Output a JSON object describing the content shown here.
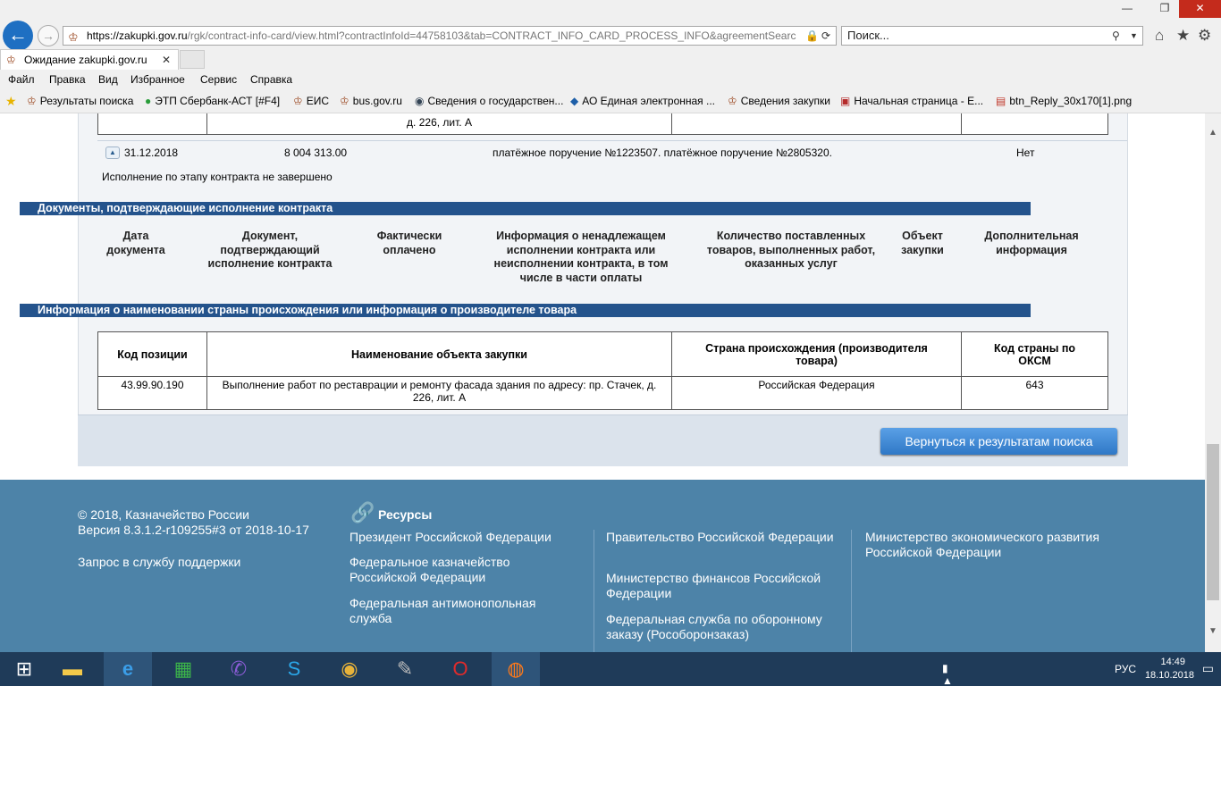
{
  "window": {
    "controls": {
      "minimize": "—",
      "maximize": "❐",
      "close": "✕"
    }
  },
  "browser": {
    "url_host": "https://zakupki.gov.ru",
    "url_rest": "/rgk/contract-info-card/view.html?contractInfoId=44758103&tab=CONTRACT_INFO_CARD_PROCESS_INFO&agreementSearc",
    "search_placeholder": "Поиск...",
    "tab_title": "Ожидание zakupki.gov.ru",
    "menu": [
      "Файл",
      "Правка",
      "Вид",
      "Избранное",
      "Сервис",
      "Справка"
    ],
    "favorites": [
      "Результаты поиска",
      "ЭТП Сбербанк-АСТ [#F4]",
      "ЕИС",
      "bus.gov.ru",
      "Сведения о государствен...",
      "АО Единая электронная ...",
      "Сведения закупки",
      "Начальная страница - E...",
      "btn_Reply_30x170[1].png"
    ]
  },
  "page": {
    "top_row_fragment": "д. 226, лит. А",
    "payment_row": {
      "date": "31.12.2018",
      "amount": "8 004 313.00",
      "docs": "платёжное поручение №1223507. платёжное поручение №2805320.",
      "flag": "Нет"
    },
    "stage_status": "Исполнение по этапу контракта не завершено",
    "section1_title": "Документы, подтверждающие исполнение контракта",
    "section1_headers": [
      "Дата документа",
      "Документ, подтверждающий исполнение контракта",
      "Фактически оплачено",
      "Информация о ненадлежащем исполнении контракта или неисполнении контракта, в том числе в части оплаты",
      "Количество поставленных товаров, выполненных работ, оказанных услуг",
      "Объект закупки",
      "Дополнительная информация"
    ],
    "section2_title": "Информация о наименовании страны происхождения или информация о производителе товара",
    "country_table": {
      "headers": [
        "Код позиции",
        "Наименование объекта закупки",
        "Страна происхождения (производителя товара)",
        "Код страны по ОКСМ"
      ],
      "row": [
        "43.99.90.190",
        "Выполнение работ по реставрации и ремонту фасада здания по адресу: пр. Стачек, д. 226, лит. А",
        "Российская Федерация",
        "643"
      ]
    },
    "back_button": "Вернуться к результатам поиска"
  },
  "footer": {
    "copyright": "© 2018, Казначейство России",
    "version": "Версия 8.3.1.2-r109255#3 от 2018-10-17",
    "support": "Запрос в службу поддержки",
    "resources_title": "Ресурсы",
    "col1": [
      "Президент Российской Федерации",
      "Федеральное казначейство Российской Федерации",
      "Федеральная антимонопольная служба"
    ],
    "col2": [
      "Правительство Российской Федерации",
      "Министерство финансов Российской Федерации",
      "Федеральная служба по оборонному заказу (Рособоронзаказ)"
    ],
    "col3": [
      "Министерство экономического развития Российской Федерации"
    ]
  },
  "taskbar": {
    "lang": "РУС",
    "time": "14:49",
    "date": "18.10.2018"
  }
}
